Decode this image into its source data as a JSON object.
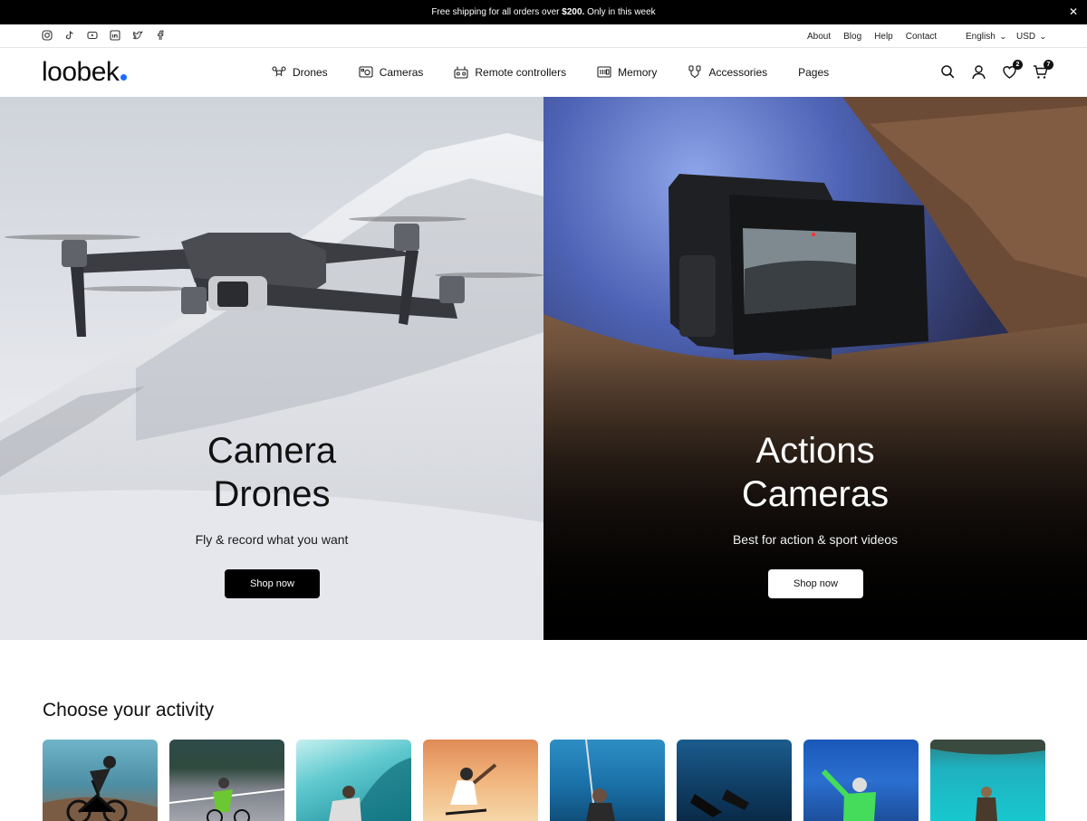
{
  "announcement": {
    "text_before": "Free shipping for all orders over ",
    "amount": "$200.",
    "text_after": " Only in this week",
    "close_icon": "close-icon"
  },
  "utility": {
    "social_icons": [
      "instagram-icon",
      "tiktok-icon",
      "youtube-icon",
      "linkedin-icon",
      "twitter-icon",
      "facebook-icon"
    ],
    "links": [
      "About",
      "Blog",
      "Help",
      "Contact"
    ],
    "language": "English",
    "currency": "USD"
  },
  "header": {
    "logo": "loobek",
    "logo_dot_color": "#1a6cff",
    "nav": [
      {
        "label": "Drones",
        "icon": "drone-icon"
      },
      {
        "label": "Cameras",
        "icon": "camera-icon"
      },
      {
        "label": "Remote controllers",
        "icon": "controller-icon"
      },
      {
        "label": "Memory",
        "icon": "memory-card-icon"
      },
      {
        "label": "Accessories",
        "icon": "accessories-icon"
      },
      {
        "label": "Pages",
        "icon": ""
      }
    ],
    "wishlist_count": "2",
    "cart_count": "7"
  },
  "hero": {
    "left": {
      "title_line1": "Camera",
      "title_line2": "Drones",
      "subtitle": "Fly & record what you want",
      "button": "Shop now"
    },
    "right": {
      "title_line1": "Actions",
      "title_line2": "Cameras",
      "subtitle": "Best for action & sport videos",
      "button": "Shop now"
    }
  },
  "activity": {
    "title": "Choose your activity",
    "items": [
      "mountain-biking",
      "road-cycling",
      "surfing",
      "skateboarding",
      "snorkeling-selfie",
      "freediving",
      "snowboarding",
      "lake-hiking"
    ]
  }
}
